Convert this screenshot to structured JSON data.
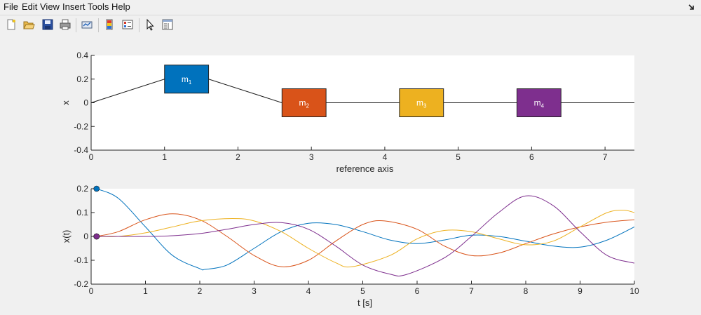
{
  "menu": {
    "items": [
      "File",
      "Edit",
      "View",
      "Insert",
      "Tools",
      "Help"
    ]
  },
  "toolbar": {
    "buttons": [
      {
        "name": "new-figure-icon"
      },
      {
        "name": "open-file-icon"
      },
      {
        "name": "save-icon"
      },
      {
        "name": "print-icon"
      },
      {
        "name": "link-plot-icon"
      },
      {
        "name": "insert-colorbar-icon"
      },
      {
        "name": "insert-legend-icon"
      },
      {
        "name": "pointer-icon"
      },
      {
        "name": "property-editor-icon"
      }
    ]
  },
  "colors": {
    "blue": "#0072bd",
    "orange": "#d95319",
    "yellow": "#edb120",
    "purple": "#7e2f8e",
    "axes_bg": "#ffffff",
    "figure_bg": "#f0f0f0"
  },
  "chart_data": [
    {
      "type": "line",
      "xlabel": "reference axis",
      "ylabel": "x",
      "xlim": [
        0,
        7.4
      ],
      "ylim": [
        -0.4,
        0.4
      ],
      "xticks": [
        "0",
        "1",
        "2",
        "3",
        "4",
        "5",
        "6",
        "7"
      ],
      "yticks": [
        "0.4",
        "0.2",
        "0",
        "-0.2",
        "-0.4"
      ],
      "spring_line": {
        "x": [
          0,
          1.0,
          1.6,
          2.6,
          3.2,
          4.2,
          4.8,
          5.8,
          6.4,
          7.4
        ],
        "y": [
          0,
          0.2,
          0.2,
          0,
          0,
          0,
          0,
          0,
          0,
          0
        ]
      },
      "masses": [
        {
          "label": "m",
          "sub": "1",
          "x_left": 1.0,
          "x_right": 1.6,
          "y_center": 0.2,
          "color": "#0072bd"
        },
        {
          "label": "m",
          "sub": "2",
          "x_left": 2.6,
          "x_right": 3.2,
          "y_center": 0.0,
          "color": "#d95319"
        },
        {
          "label": "m",
          "sub": "3",
          "x_left": 4.2,
          "x_right": 4.8,
          "y_center": 0.0,
          "color": "#edb120"
        },
        {
          "label": "m",
          "sub": "4",
          "x_left": 5.8,
          "x_right": 6.4,
          "y_center": 0.0,
          "color": "#7e2f8e"
        }
      ]
    },
    {
      "type": "line",
      "xlabel": "t [s]",
      "ylabel": "x(t)",
      "xlim": [
        0,
        10
      ],
      "ylim": [
        -0.2,
        0.2
      ],
      "xticks": [
        "0",
        "1",
        "2",
        "3",
        "4",
        "5",
        "6",
        "7",
        "8",
        "9",
        "10"
      ],
      "yticks": [
        "0.2",
        "0.1",
        "0",
        "-0.1",
        "-0.2"
      ],
      "series": [
        {
          "color": "#0072bd",
          "x": [
            0.1,
            0.5,
            1.0,
            1.5,
            2.0,
            2.1,
            2.5,
            3.0,
            3.5,
            4.0,
            4.5,
            5.0,
            5.5,
            6.0,
            6.5,
            7.0,
            7.5,
            8.0,
            8.5,
            9.0,
            9.5,
            10.0
          ],
          "y": [
            0.2,
            0.16,
            0.04,
            -0.08,
            -0.135,
            -0.138,
            -0.12,
            -0.05,
            0.02,
            0.055,
            0.05,
            0.02,
            -0.015,
            -0.03,
            -0.015,
            0.005,
            0.0,
            -0.02,
            -0.04,
            -0.045,
            -0.015,
            0.04
          ]
        },
        {
          "color": "#d95319",
          "x": [
            0.1,
            0.5,
            1.0,
            1.5,
            2.0,
            2.5,
            3.0,
            3.5,
            4.0,
            4.5,
            5.0,
            5.4,
            6.0,
            6.5,
            7.0,
            7.5,
            8.0,
            8.5,
            9.0,
            9.5,
            10.0
          ],
          "y": [
            0.0,
            0.02,
            0.07,
            0.095,
            0.07,
            0.0,
            -0.08,
            -0.127,
            -0.1,
            -0.02,
            0.05,
            0.065,
            0.03,
            -0.04,
            -0.08,
            -0.07,
            -0.03,
            0.01,
            0.04,
            0.06,
            0.07
          ]
        },
        {
          "color": "#edb120",
          "x": [
            0.1,
            0.5,
            1.0,
            1.5,
            2.0,
            2.6,
            3.0,
            3.5,
            4.0,
            4.5,
            4.8,
            5.5,
            6.0,
            6.5,
            7.0,
            7.5,
            8.0,
            8.5,
            9.0,
            9.5,
            9.8,
            10.0
          ],
          "y": [
            0.0,
            0.0,
            0.015,
            0.04,
            0.065,
            0.075,
            0.065,
            0.02,
            -0.05,
            -0.11,
            -0.127,
            -0.08,
            -0.01,
            0.025,
            0.02,
            -0.01,
            -0.035,
            -0.02,
            0.04,
            0.1,
            0.11,
            0.1
          ]
        },
        {
          "color": "#7e2f8e",
          "x": [
            0.1,
            0.5,
            1.0,
            1.5,
            2.0,
            2.5,
            3.0,
            3.5,
            4.0,
            4.5,
            5.0,
            5.5,
            5.8,
            6.5,
            7.0,
            7.5,
            8.0,
            8.5,
            9.0,
            9.5,
            10.0
          ],
          "y": [
            0.0,
            0.0,
            0.0,
            0.003,
            0.012,
            0.03,
            0.05,
            0.058,
            0.03,
            -0.04,
            -0.12,
            -0.158,
            -0.16,
            -0.09,
            0.0,
            0.1,
            0.17,
            0.13,
            0.02,
            -0.08,
            -0.112
          ]
        }
      ],
      "start_markers": [
        {
          "x": 0.1,
          "y": 0.2,
          "color": "#0072bd"
        },
        {
          "x": 0.1,
          "y": 0.0,
          "color": "#d95319"
        },
        {
          "x": 0.1,
          "y": 0.0,
          "color": "#edb120"
        },
        {
          "x": 0.1,
          "y": 0.0,
          "color": "#7e2f8e"
        }
      ]
    }
  ]
}
